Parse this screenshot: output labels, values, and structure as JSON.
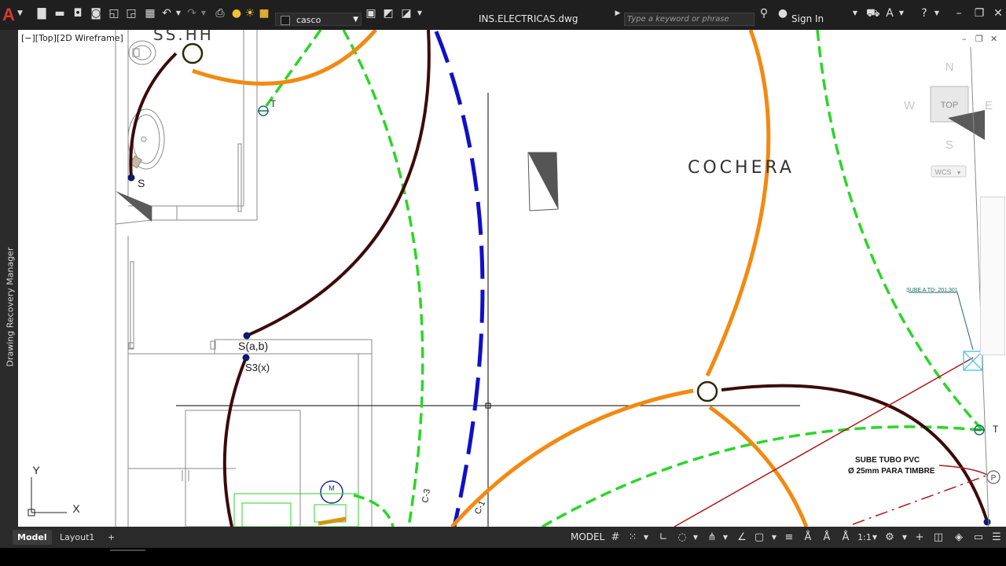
{
  "app": {
    "logo": "A",
    "layer_name": "casco",
    "document_title": "INS.ELECTRICAS.dwg",
    "search_placeholder": "Type a keyword or phrase",
    "sign_in": "Sign In"
  },
  "side_panel": {
    "label": "Drawing Recovery Manager"
  },
  "viewport": {
    "label": "[−][Top][2D Wireframe]"
  },
  "drawing": {
    "room_ssHH": "SS.HH",
    "room_cochera": "COCHERA",
    "switch_s": "S",
    "switch_sab": "S(a,b)",
    "switch_s3x": "S3(x)",
    "tag_t": "T",
    "tag_c3": "C-3",
    "tag_c1": "C-1",
    "tag_m": "M",
    "tag_p": "P",
    "note_ato": "SUBE A TD- 201,301",
    "note_pvc_1": "SUBE TUBO PVC",
    "note_pvc_2": "Ø 25mm PARA TIMBRE"
  },
  "viewcube": {
    "north": "N",
    "south": "S",
    "east": "E",
    "west": "W",
    "face": "TOP",
    "wcs": "WCS"
  },
  "ucs": {
    "x": "X",
    "y": "Y"
  },
  "status": {
    "tab_model": "Model",
    "tab_layout1": "Layout1",
    "add_tab": "+",
    "model_space": "MODEL",
    "scale": "1:1"
  },
  "colors": {
    "orange_wire": "#f28a11",
    "dark_wire": "#3d0a0a",
    "green_wire": "#2bd629",
    "blue_wire": "#1010c8",
    "titlebar": "#1f1f1f"
  }
}
